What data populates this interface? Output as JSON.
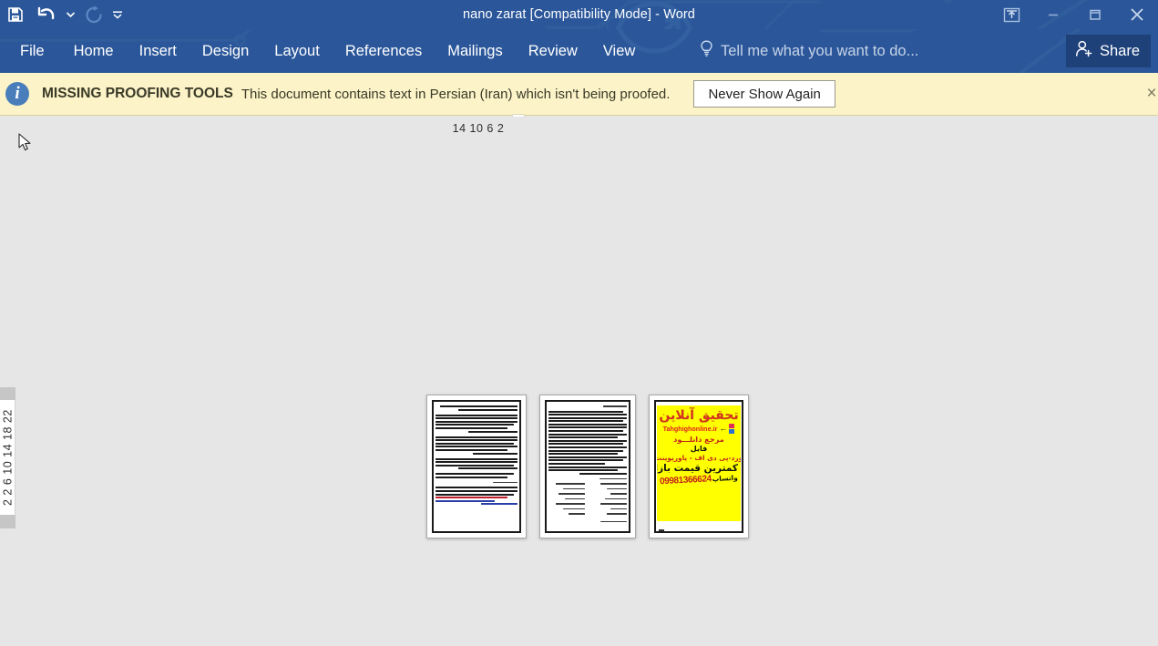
{
  "window": {
    "title": "nano zarat [Compatibility Mode] - Word",
    "quick_access": [
      {
        "name": "save",
        "label": "Save",
        "icon": "save-icon"
      },
      {
        "name": "undo",
        "label": "Undo",
        "icon": "undo-icon"
      },
      {
        "name": "undo-dropdown",
        "label": "Undo options",
        "icon": "chevron-down-icon"
      },
      {
        "name": "redo",
        "label": "Repeat",
        "icon": "redo-icon",
        "disabled": true
      },
      {
        "name": "customize-qat",
        "label": "Customize Quick Access Toolbar",
        "icon": "chevron-down-icon"
      }
    ],
    "controls": [
      {
        "name": "ribbon-display-options",
        "label": "Ribbon Display Options",
        "icon": "ribbon-display-icon"
      },
      {
        "name": "minimize",
        "label": "Minimize",
        "icon": "minimize-icon"
      },
      {
        "name": "restore",
        "label": "Restore Down",
        "icon": "restore-icon"
      },
      {
        "name": "close",
        "label": "Close",
        "icon": "close-icon"
      }
    ]
  },
  "ribbon": {
    "tabs": [
      {
        "id": "file",
        "label": "File"
      },
      {
        "id": "home",
        "label": "Home"
      },
      {
        "id": "insert",
        "label": "Insert"
      },
      {
        "id": "design",
        "label": "Design"
      },
      {
        "id": "layout",
        "label": "Layout"
      },
      {
        "id": "references",
        "label": "References"
      },
      {
        "id": "mailings",
        "label": "Mailings"
      },
      {
        "id": "review",
        "label": "Review"
      },
      {
        "id": "view",
        "label": "View"
      }
    ],
    "tell_me": {
      "placeholder": "Tell me what you want to do...",
      "icon": "lightbulb-icon"
    },
    "share": {
      "label": "Share",
      "icon": "share-person-icon"
    }
  },
  "message_bar": {
    "icon": "info-icon",
    "title": "MISSING PROOFING TOOLS",
    "text": "This document contains text in Persian (Iran) which isn't being proofed.",
    "action_label": "Never Show Again",
    "close_label": "×",
    "background": "#fcf3c8"
  },
  "rulers": {
    "tab_stop_selector": {
      "name": "left-tab-stop",
      "icon": "tab-stop-icon"
    },
    "horizontal": {
      "ticks": "14 10  6   2"
    },
    "vertical": {
      "ticks": "2  2  6  10  14  18  22"
    }
  },
  "document": {
    "zoom_view": "multi-page",
    "pages": [
      {
        "number": 1,
        "type": "text",
        "language": "fa-IR",
        "has_border_frame": true,
        "paragraphs": [
          [
            "s95",
            "s100",
            "s88",
            "s60"
          ],
          [
            "s95",
            "s100",
            "s95",
            "s100",
            "s88",
            "s72"
          ],
          [
            "s95",
            "s100",
            "s95",
            "s88",
            "s100",
            "s55"
          ],
          [
            "s95",
            "s100",
            "s88",
            "s72",
            "s45"
          ],
          [
            "s95",
            "s88",
            "s60"
          ]
        ],
        "signature_line": "s35",
        "footer_note_lines": [
          "s95",
          "s88",
          "s100",
          "s72"
        ],
        "has_red_mark": true,
        "has_hyperlink": true
      },
      {
        "number": 2,
        "type": "text-and-list",
        "language": "fa-IR",
        "has_border_frame": true,
        "heading": "s30",
        "body_lines": [
          "s95",
          "s100",
          "s95",
          "s100",
          "s95",
          "s100",
          "s88",
          "s100",
          "s95",
          "s100",
          "s95",
          "s88",
          "s100",
          "s95",
          "s72",
          "s100",
          "s88",
          "s95",
          "s60"
        ],
        "list_heading": "s35",
        "list_rows": 7,
        "footer": "s30"
      },
      {
        "number": 3,
        "type": "advertisement",
        "language": "fa-IR",
        "has_border_frame": true,
        "background": "#ffff00",
        "ad": {
          "title": "تحقیق آنلاین",
          "url": "Tahghighonline.ir",
          "line1": "مرجع دانلـــود",
          "line2": "فایل",
          "line3": "ورد-پی دی اف - پاورپوینت",
          "line4": "با کمترین قیمت بازار",
          "phone": "09981366624",
          "whatsapp": "واتساپ",
          "arrow": "←"
        }
      }
    ]
  },
  "colors": {
    "chrome": "#2b579a",
    "share_button": "#1e417a",
    "canvas": "#e6e6e6",
    "message_bar": "#fcf3c8",
    "message_bar_border": "#d9cf9a",
    "ad_yellow": "#ffff00",
    "ad_red": "#c2241a"
  }
}
